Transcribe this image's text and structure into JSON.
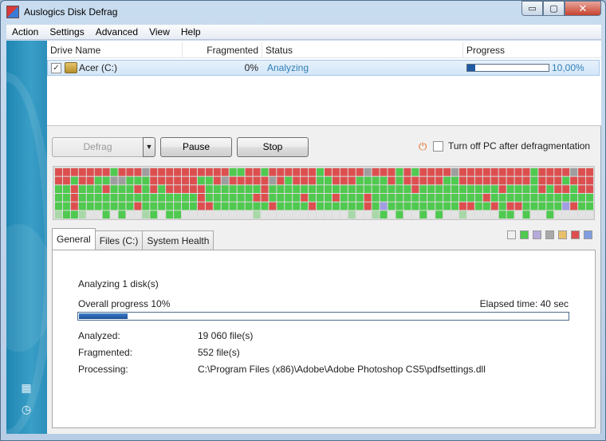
{
  "window": {
    "title": "Auslogics Disk Defrag",
    "min_glyph": "▭",
    "max_glyph": "▢",
    "close_glyph": "✕"
  },
  "menu": [
    "Action",
    "Settings",
    "Advanced",
    "View",
    "Help"
  ],
  "drive_table": {
    "headers": {
      "drive_name": "Drive Name",
      "fragmented": "Fragmented",
      "status": "Status",
      "progress": "Progress"
    },
    "rows": [
      {
        "checked": true,
        "check_glyph": "✓",
        "drive": "Acer (C:)",
        "fragmented": "0%",
        "status": "Analyzing",
        "progress_text": "10,00%",
        "progress": 0.1
      }
    ]
  },
  "controls": {
    "defrag_label": "Defrag",
    "dropdown_glyph": "▼",
    "pause_label": "Pause",
    "stop_label": "Stop",
    "power_glyph": "⏻",
    "turnoff_label": "Turn off PC after defragmentation",
    "turnoff_checked": false
  },
  "cluster_map": {
    "columns": 68,
    "rows": 6,
    "colors": {
      "fragmented": "#dd4f4f",
      "defragmented": "#4fc94f",
      "system": "#9e9e9e",
      "free": "#e3e3e3",
      "mft": "#9f9ee0",
      "pagefile": "#a8d8a8"
    }
  },
  "tabs": [
    {
      "label": "General",
      "active": true
    },
    {
      "label": "Files (C:)",
      "active": false
    },
    {
      "label": "System Health",
      "active": false
    }
  ],
  "legend_colors": [
    "#f0f0f0",
    "#4fc94f",
    "#b7a9d9",
    "#a9a9a9",
    "#e8c069",
    "#dd4f4f",
    "#7f9de0"
  ],
  "general": {
    "analyzing_text": "Analyzing 1 disk(s)",
    "overall_progress_label": "Overall progress 10%",
    "overall_progress": 0.1,
    "elapsed_label": "Elapsed time: 40 sec",
    "analyzed_label": "Analyzed:",
    "analyzed_value": "19 060 file(s)",
    "fragmented_label": "Fragmented:",
    "fragmented_value": "552 file(s)",
    "processing_label": "Processing:",
    "processing_value": "C:\\Program Files (x86)\\Adobe\\Adobe Photoshop CS5\\pdfsettings.dll"
  },
  "sidebar": {
    "map_icon_glyph": "▦",
    "clock_icon_glyph": "◷"
  }
}
